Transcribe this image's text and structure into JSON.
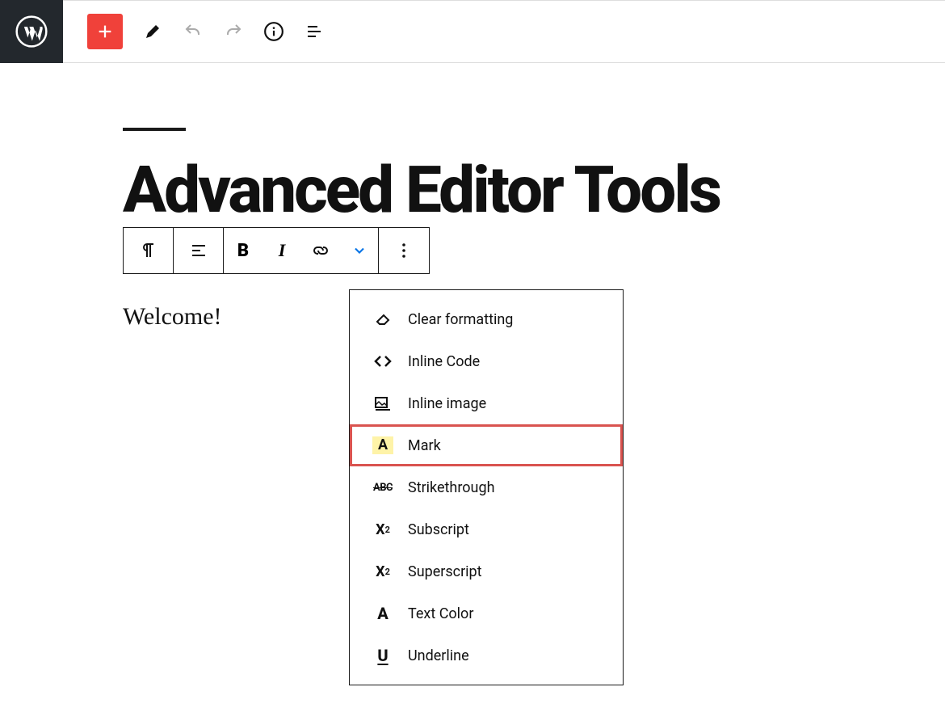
{
  "page": {
    "title": "Advanced Editor Tools",
    "welcome_text": "Welcome!"
  },
  "popover": {
    "items": [
      {
        "label": "Clear formatting"
      },
      {
        "label": "Inline Code"
      },
      {
        "label": "Inline image"
      },
      {
        "label": "Mark",
        "highlighted": true
      },
      {
        "label": "Strikethrough"
      },
      {
        "label": "Subscript"
      },
      {
        "label": "Superscript"
      },
      {
        "label": "Text Color"
      },
      {
        "label": "Underline"
      }
    ]
  }
}
